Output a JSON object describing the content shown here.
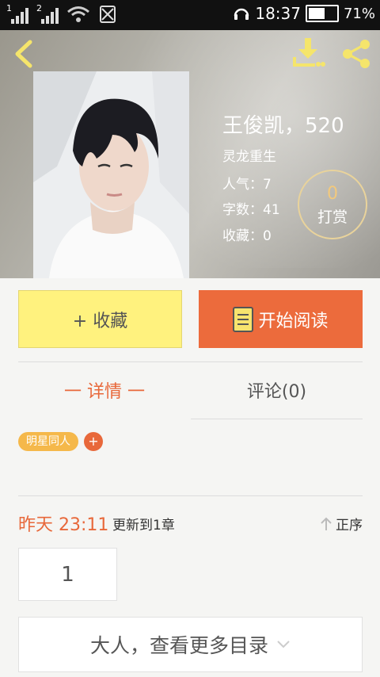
{
  "status_bar": {
    "sim1": "1",
    "sim2": "2",
    "time": "18:37",
    "battery": "71%",
    "battery_level": 0.71
  },
  "book": {
    "title": "王俊凯，520",
    "category": "灵龙重生",
    "popularity": "人气：7",
    "word_count": "字数：41",
    "favorites": "收藏：0",
    "tip_count": "0",
    "tip_label": "打赏"
  },
  "actions": {
    "favorite_label": "+ 收藏",
    "read_label": "开始阅读"
  },
  "tabs": [
    {
      "label": "一 详情 一",
      "active": true
    },
    {
      "label": "评论(0)",
      "active": false
    }
  ],
  "tags": [
    "明星同人"
  ],
  "tag_add": "+",
  "update": {
    "time": "昨天 23:11",
    "text": "更新到1章",
    "order_label": "正序"
  },
  "chapters": [
    "1"
  ],
  "more_label": "大人，查看更多目录",
  "colors": {
    "accent": "#e8683a",
    "favorite_bg": "#fff27e",
    "read_bg": "#ec6b3c",
    "tag": "#f5b84a",
    "icon_yellow": "#f5e56b"
  }
}
